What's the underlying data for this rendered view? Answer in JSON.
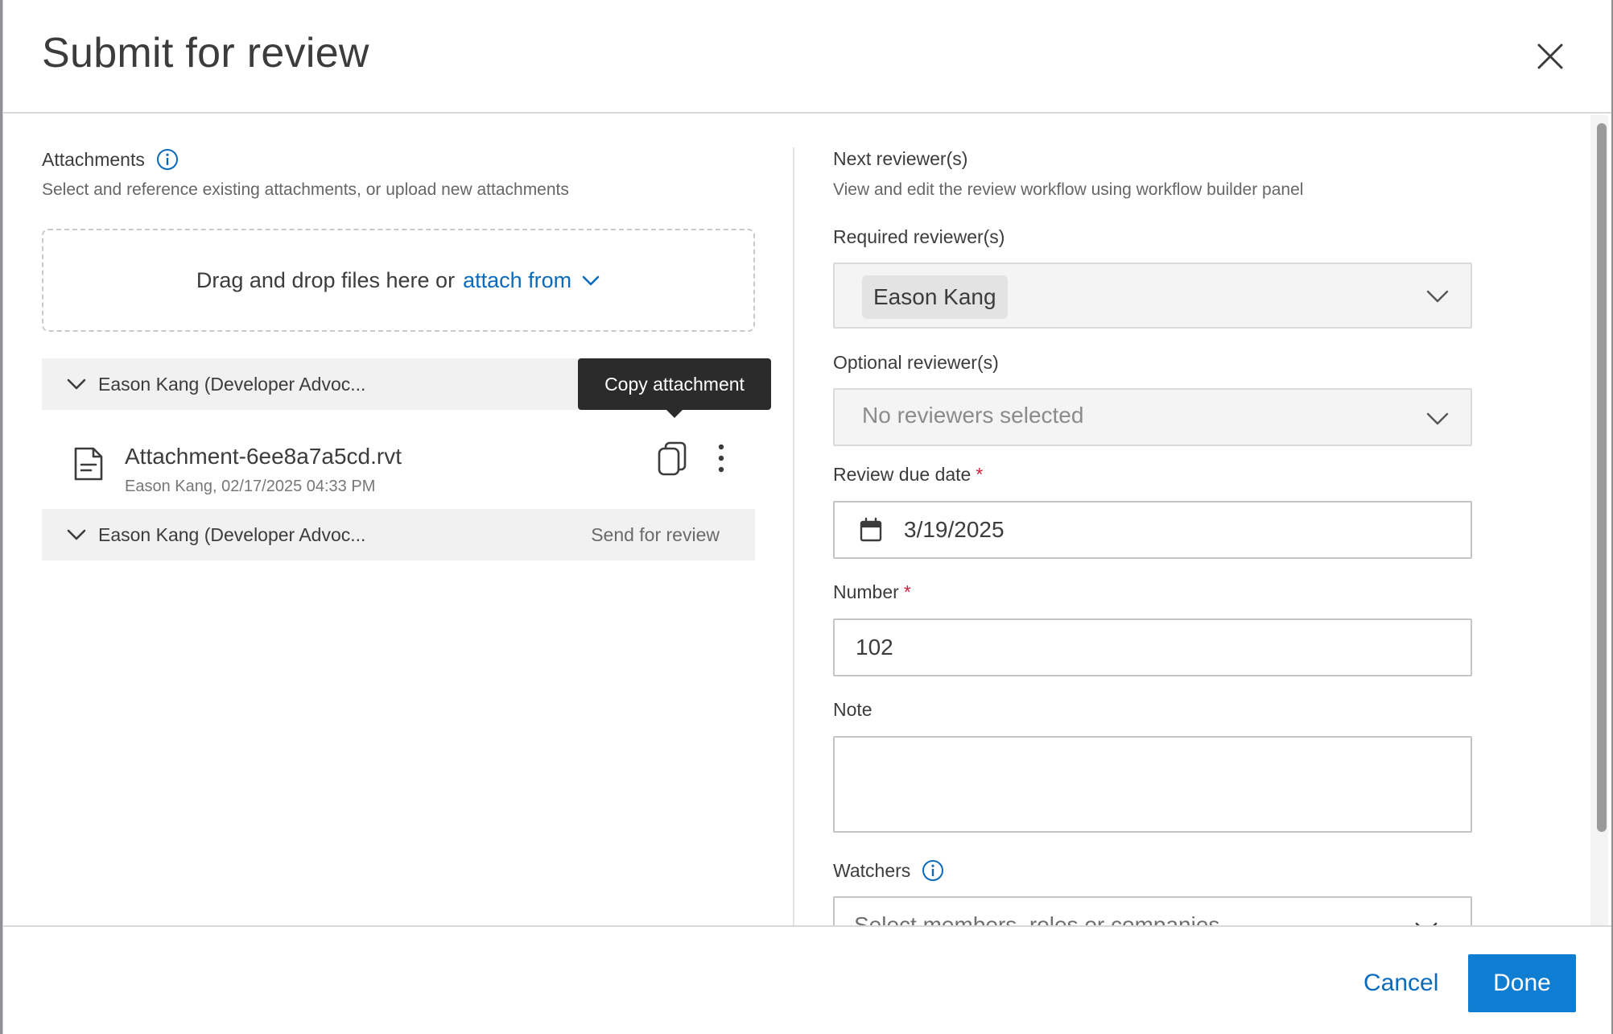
{
  "dialog": {
    "title": "Submit for review",
    "close_icon": "close-icon"
  },
  "attachments": {
    "label": "Attachments",
    "info_icon": "info-icon",
    "description": "Select and reference existing attachments, or upload new attachments",
    "dropzone_text": "Drag and drop files here or",
    "attach_from_link": "attach from",
    "groups": [
      {
        "title": "Eason Kang (Developer Advoc...",
        "action": ""
      },
      {
        "title": "Eason Kang (Developer Advoc...",
        "action": "Send for review"
      }
    ],
    "file": {
      "name": "Attachment-6ee8a7a5cd.rvt",
      "meta": "Eason Kang, 02/17/2025 04:33 PM"
    },
    "tooltip": "Copy attachment"
  },
  "reviewers": {
    "label": "Next reviewer(s)",
    "description": "View and edit the review workflow using workflow builder panel",
    "required_label": "Required reviewer(s)",
    "required_value": "Eason Kang",
    "optional_label": "Optional reviewer(s)",
    "optional_placeholder": "No reviewers selected",
    "due_date_label": "Review due date",
    "due_date_value": "3/19/2025",
    "required_marker": "*",
    "number_label": "Number",
    "number_value": "102",
    "note_label": "Note",
    "note_value": "",
    "watchers_label": "Watchers",
    "watchers_placeholder": "Select members, roles or companies"
  },
  "footer": {
    "cancel_label": "Cancel",
    "done_label": "Done"
  },
  "colors": {
    "accent": "#0f7dd1",
    "link": "#0a6bbd",
    "required": "#d1203e",
    "tooltip_bg": "#2b2b2b"
  }
}
